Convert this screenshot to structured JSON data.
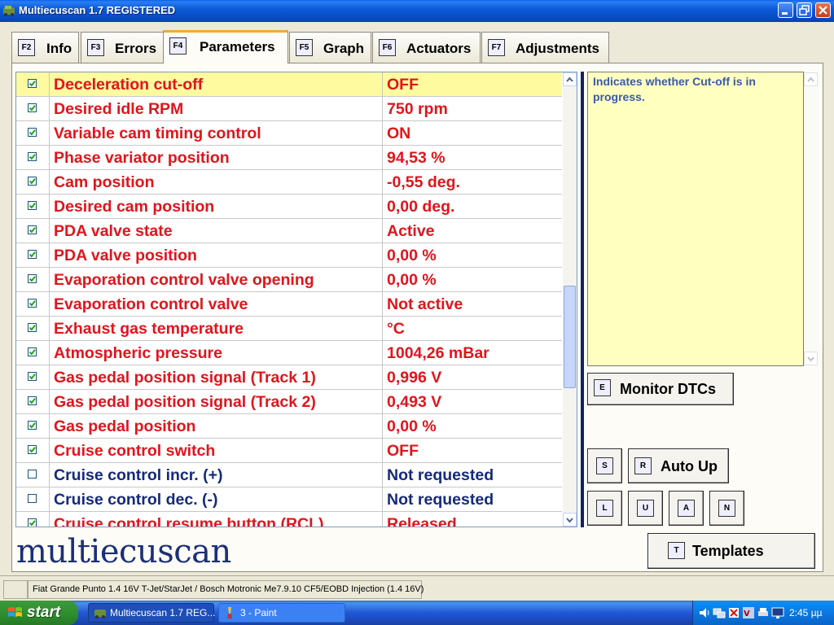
{
  "window": {
    "title": "Multiecuscan 1.7 REGISTERED"
  },
  "tabs": [
    {
      "key": "F2",
      "label": "Info"
    },
    {
      "key": "F3",
      "label": "Errors"
    },
    {
      "key": "F4",
      "label": "Parameters",
      "active": true
    },
    {
      "key": "F5",
      "label": "Graph"
    },
    {
      "key": "F6",
      "label": "Actuators"
    },
    {
      "key": "F7",
      "label": "Adjustments"
    }
  ],
  "parameters": [
    {
      "name": "Deceleration cut-off",
      "value": "OFF",
      "checked": true,
      "color": "red",
      "selected": true
    },
    {
      "name": "Desired idle RPM",
      "value": "750 rpm",
      "checked": true,
      "color": "red"
    },
    {
      "name": "Variable cam timing control",
      "value": "ON",
      "checked": true,
      "color": "red"
    },
    {
      "name": "Phase variator position",
      "value": "94,53 %",
      "checked": true,
      "color": "red"
    },
    {
      "name": "Cam position",
      "value": "-0,55 deg.",
      "checked": true,
      "color": "red"
    },
    {
      "name": "Desired cam position",
      "value": "0,00 deg.",
      "checked": true,
      "color": "red"
    },
    {
      "name": "PDA valve state",
      "value": "Active",
      "checked": true,
      "color": "red"
    },
    {
      "name": "PDA valve position",
      "value": "0,00 %",
      "checked": true,
      "color": "red"
    },
    {
      "name": "Evaporation control valve opening",
      "value": "0,00 %",
      "checked": true,
      "color": "red"
    },
    {
      "name": "Evaporation control valve",
      "value": "Not active",
      "checked": true,
      "color": "red"
    },
    {
      "name": "Exhaust gas temperature",
      "value": " °C",
      "checked": true,
      "color": "red"
    },
    {
      "name": "Atmospheric pressure",
      "value": "1004,26 mBar",
      "checked": true,
      "color": "red"
    },
    {
      "name": "Gas pedal position signal (Track 1)",
      "value": "0,996 V",
      "checked": true,
      "color": "red"
    },
    {
      "name": "Gas pedal position signal (Track 2)",
      "value": "0,493 V",
      "checked": true,
      "color": "red"
    },
    {
      "name": "Gas pedal position",
      "value": "0,00 %",
      "checked": true,
      "color": "red"
    },
    {
      "name": "Cruise control switch",
      "value": "OFF",
      "checked": true,
      "color": "red"
    },
    {
      "name": "Cruise control incr. (+)",
      "value": "Not requested",
      "checked": false,
      "color": "blue"
    },
    {
      "name": "Cruise control dec. (-)",
      "value": "Not requested",
      "checked": false,
      "color": "blue"
    },
    {
      "name": "Cruise control resume button (RCL)",
      "value": "Released",
      "checked": true,
      "color": "red"
    }
  ],
  "description": "Indicates whether Cut-off is in progress.",
  "buttons": {
    "monitor_key": "E",
    "monitor_label": "Monitor DTCs",
    "s_key": "S",
    "r_key": "R",
    "autoup_label": "Auto Up",
    "l_key": "L",
    "u_key": "U",
    "a_key": "A",
    "n_key": "N",
    "templates_key": "T",
    "templates_label": "Templates"
  },
  "logo": "multiecuscan",
  "status": {
    "vehicle": "Fiat Grande Punto 1.4 16V T-Jet/StarJet / Bosch Motronic Me7.9.10 CF5/EOBD Injection (1.4 16V)"
  },
  "taskbar": {
    "start": "start",
    "items": [
      "Multiecuscan 1.7 REG...",
      "3 - Paint"
    ],
    "clock": "2:45 µµ"
  },
  "colors": {
    "param_red": "#e0151b",
    "param_blue": "#152a7a",
    "selected_row": "#fdfaa0",
    "description_bg": "#ffffc0"
  }
}
